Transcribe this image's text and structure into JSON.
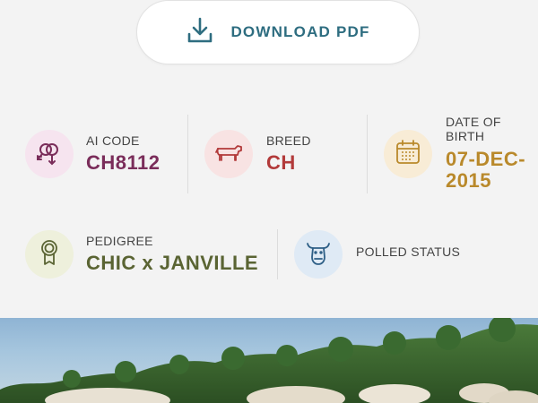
{
  "download": {
    "label": "DOWNLOAD PDF",
    "icon": "download-icon"
  },
  "fields": {
    "ai_code": {
      "label": "AI CODE",
      "value": "CH8112",
      "icon": "gender-symbols-icon",
      "color": "#7a2d5a",
      "bg": "#f6e4ef"
    },
    "breed": {
      "label": "BREED",
      "value": "CH",
      "icon": "cow-icon",
      "color": "#b23a3a",
      "bg": "#f8e3e3"
    },
    "dob": {
      "label_line1": "DATE OF",
      "label_line2": "BIRTH",
      "value_line1": "07-DEC-",
      "value_line2": "2015",
      "icon": "calendar-icon",
      "color": "#b9892b",
      "bg": "#f8ecd6"
    },
    "pedigree": {
      "label": "PEDIGREE",
      "value": "CHIC x JANVILLE",
      "icon": "award-ribbon-icon",
      "color": "#5a6433",
      "bg": "#eef0dc"
    },
    "polled": {
      "label": "POLLED STATUS",
      "icon": "bull-head-icon",
      "color": "#2e5f86",
      "bg": "#dfeaf5"
    }
  },
  "photo": {
    "description_icon": "cattle-photo"
  }
}
